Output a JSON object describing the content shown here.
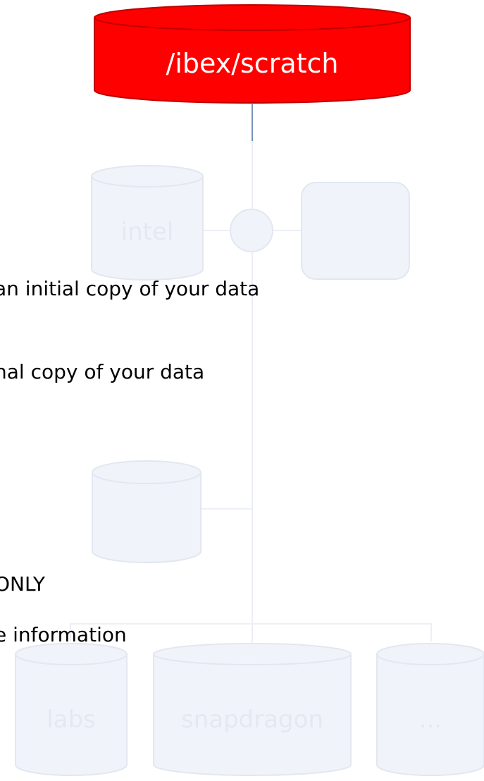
{
  "colors": {
    "main_fill": "#ff0000",
    "main_stroke": "#c00000",
    "main_text": "#ffffff",
    "connector": "#4a6fa5",
    "faded_fill": "#f0f3fa",
    "faded_stroke": "#e2e7f0",
    "faded_line": "#eceff5",
    "faded_text": "#e4e8f0",
    "body_text": "#000000"
  },
  "main_storage": {
    "label": "/ibex/scratch"
  },
  "background_nodes": {
    "intel": "intel",
    "labs": "labs",
    "snapdragon": "snapdragon",
    "more": "..."
  },
  "text_lines": [
    "an initial copy of your data",
    "nal copy of your data",
    "ONLY",
    "e information"
  ]
}
